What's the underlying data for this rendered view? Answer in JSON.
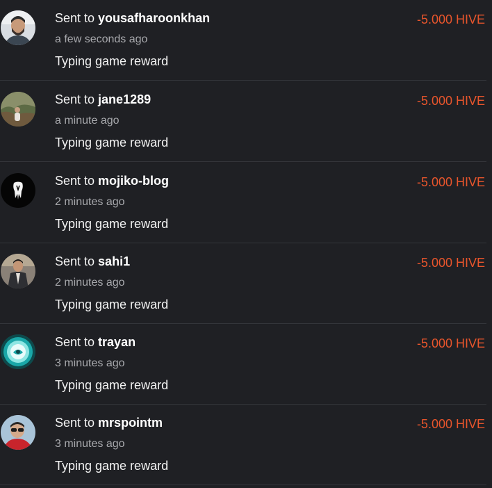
{
  "transactions": [
    {
      "prefix": "Sent to ",
      "user": "yousafharoonkhan",
      "time": "a few seconds ago",
      "memo": "Typing game reward",
      "amount": "-5.000 HIVE",
      "avatar": "avatar-man-beard-icon"
    },
    {
      "prefix": "Sent to ",
      "user": "jane1289",
      "time": "a minute ago",
      "memo": "Typing game reward",
      "amount": "-5.000 HIVE",
      "avatar": "avatar-outdoor-person-icon"
    },
    {
      "prefix": "Sent to ",
      "user": "mojiko-blog",
      "time": "2 minutes ago",
      "memo": "Typing game reward",
      "amount": "-5.000 HIVE",
      "avatar": "avatar-tooth-logo-icon"
    },
    {
      "prefix": "Sent to ",
      "user": "sahi1",
      "time": "2 minutes ago",
      "memo": "Typing game reward",
      "amount": "-5.000 HIVE",
      "avatar": "avatar-man-standing-icon"
    },
    {
      "prefix": "Sent to ",
      "user": "trayan",
      "time": "3 minutes ago",
      "memo": "Typing game reward",
      "amount": "-5.000 HIVE",
      "avatar": "avatar-teal-emblem-icon"
    },
    {
      "prefix": "Sent to ",
      "user": "mrspointm",
      "time": "3 minutes ago",
      "memo": "Typing game reward",
      "amount": "-5.000 HIVE",
      "avatar": "avatar-sunglasses-person-icon"
    }
  ],
  "colors": {
    "background": "#1f2024",
    "amount": "#e8552c",
    "secondary_text": "#a8a9ad",
    "divider": "#34363b"
  }
}
